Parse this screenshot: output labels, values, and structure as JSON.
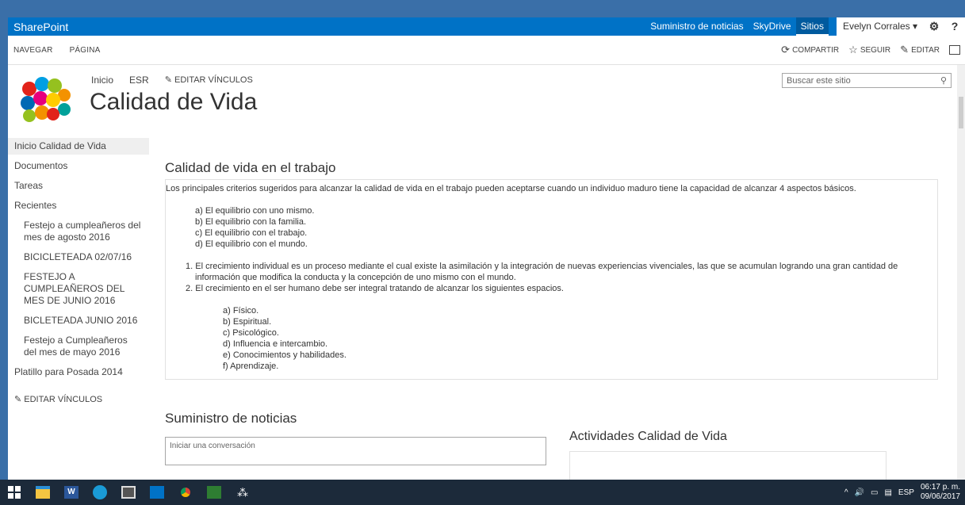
{
  "suite": {
    "brand": "SharePoint",
    "links": [
      "Suministro de noticias",
      "SkyDrive",
      "Sitios"
    ],
    "user": "Evelyn Corrales ▾",
    "gear": "⚙",
    "help": "?"
  },
  "ribbon": {
    "tabs": [
      "NAVEGAR",
      "PÁGINA"
    ],
    "share": "COMPARTIR",
    "follow": "SEGUIR",
    "edit": "EDITAR"
  },
  "breadcrumb": [
    "Inicio",
    "ESR"
  ],
  "edit_links": "EDITAR VÍNCULOS",
  "site_title": "Calidad de Vida",
  "search": {
    "placeholder": "Buscar este sitio"
  },
  "leftnav": {
    "items": [
      "Inicio Calidad de Vida",
      "Documentos",
      "Tareas",
      "Recientes"
    ],
    "recent": [
      "Festejo a cumpleañeros del mes de agosto 2016",
      "BICICLETEADA 02/07/16",
      "FESTEJO A CUMPLEAÑEROS DEL MES DE JUNIO 2016",
      "BICLETEADA JUNIO 2016",
      "Festejo a Cumpleañeros del mes de mayo 2016"
    ],
    "last": "Platillo para Posada 2014",
    "edit_links": "EDITAR VÍNCULOS"
  },
  "content": {
    "heading": "Calidad de vida en el trabajo",
    "intro": "Los principales criterios sugeridos para alcanzar la calidad de vida en el trabajo pueden aceptarse cuando un individuo maduro tiene la capacidad de alcanzar 4 aspectos básicos.",
    "aspects": [
      "a) El equilibrio con uno mismo.",
      "b) El equilibrio con la familia.",
      "c) El equilibrio con el trabajo.",
      "d) El equilibrio con el mundo."
    ],
    "n1": "1. El crecimiento individual es un proceso mediante el cual existe la asimilación y la integración de nuevas experiencias vivenciales, las que se acumulan logrando una gran cantidad de información que modifica la conducta y la concepción de uno mismo con el mundo.",
    "n2": "2. El crecimiento en el ser humano debe ser integral tratando de alcanzar los siguientes espacios.",
    "spaces": [
      "a) Físico.",
      "b) Espiritual.",
      "c) Psicológico.",
      "d) Influencia e intercambio.",
      "e) Conocimientos y habilidades.",
      "f) Aprendizaje."
    ]
  },
  "news": {
    "heading": "Suministro de noticias",
    "conv_placeholder": "Iniciar una conversación"
  },
  "activities": {
    "heading": "Actividades Calidad de Vida"
  },
  "taskbar": {
    "lang": "ESP",
    "time": "06:17 p. m.",
    "date": "09/06/2017"
  }
}
